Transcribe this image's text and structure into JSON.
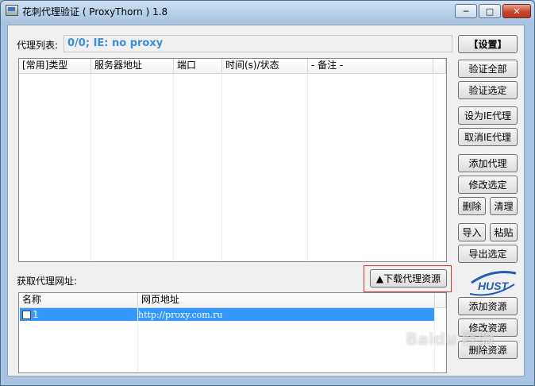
{
  "window": {
    "title": "花刺代理验证 ( ProxyThorn ) 1.8",
    "controls": {
      "minimize": "─",
      "maximize": "□",
      "close": "✕"
    }
  },
  "proxy_list": {
    "label": "代理列表:",
    "status_text": "0/0;    IE: no proxy",
    "columns": [
      "[常用]类型",
      "服务器地址",
      "端口",
      "时间(s)/状态",
      "- 备注 -"
    ]
  },
  "fetch_section": {
    "label": "获取代理网址:",
    "download_button": "▲下载代理资源",
    "columns": [
      "名称",
      "网页地址"
    ],
    "rows": [
      {
        "name": "1",
        "url": "http://proxy.com.ru",
        "checked": false
      }
    ]
  },
  "buttons": {
    "settings": "【设置】",
    "verify_all": "验证全部",
    "verify_selected": "验证选定",
    "set_ie_proxy": "设为IE代理",
    "cancel_ie_proxy": "取消IE代理",
    "add_proxy": "添加代理",
    "edit_selected": "修改选定",
    "delete": "删除",
    "clear": "清理",
    "import": "导入",
    "paste": "粘贴",
    "export_selected": "导出选定",
    "add_resource": "添加资源",
    "edit_resource": "修改资源",
    "delete_resource": "删除资源"
  },
  "logo": {
    "text": "HUST"
  },
  "watermark": {
    "text": "Baidu 经验"
  },
  "colors": {
    "status_text": "#3a8fd8",
    "selection": "#3399ff",
    "highlight_frame": "#dd3333",
    "logo_blue": "#1f5fb4"
  }
}
